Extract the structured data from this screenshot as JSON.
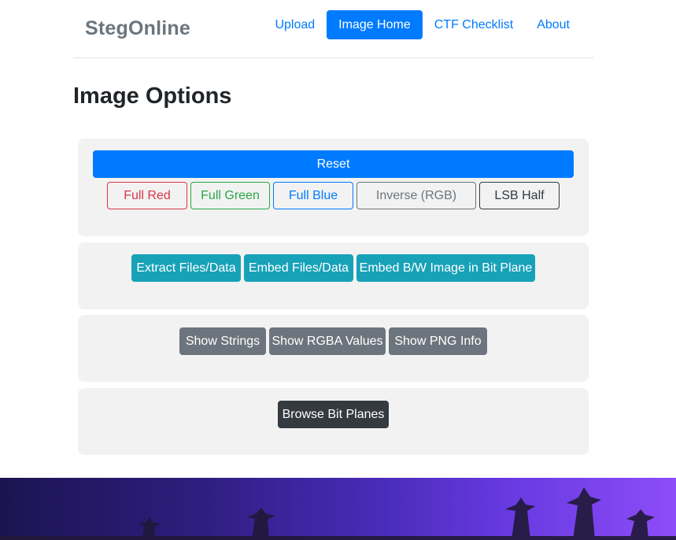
{
  "navbar": {
    "brand": "StegOnline",
    "links": [
      "Upload",
      "Image Home",
      "CTF Checklist",
      "About"
    ]
  },
  "page": {
    "title": "Image Options"
  },
  "color_panel": {
    "reset_label": "Reset",
    "buttons": [
      "Full Red",
      "Full Green",
      "Full Blue",
      "Inverse (RGB)",
      "LSB Half"
    ]
  },
  "file_panel": {
    "buttons": [
      "Extract Files/Data",
      "Embed Files/Data",
      "Embed B/W Image in Bit Plane"
    ]
  },
  "info_panel": {
    "buttons": [
      "Show Strings",
      "Show RGBA Values",
      "Show PNG Info"
    ]
  },
  "bitplane_panel": {
    "buttons": [
      "Browse Bit Planes"
    ]
  },
  "colors": {
    "primary": "#007bff",
    "danger": "#dc3545",
    "success": "#28a745",
    "secondary": "#6c757d",
    "dark": "#343a40",
    "info": "#17a2b8"
  }
}
